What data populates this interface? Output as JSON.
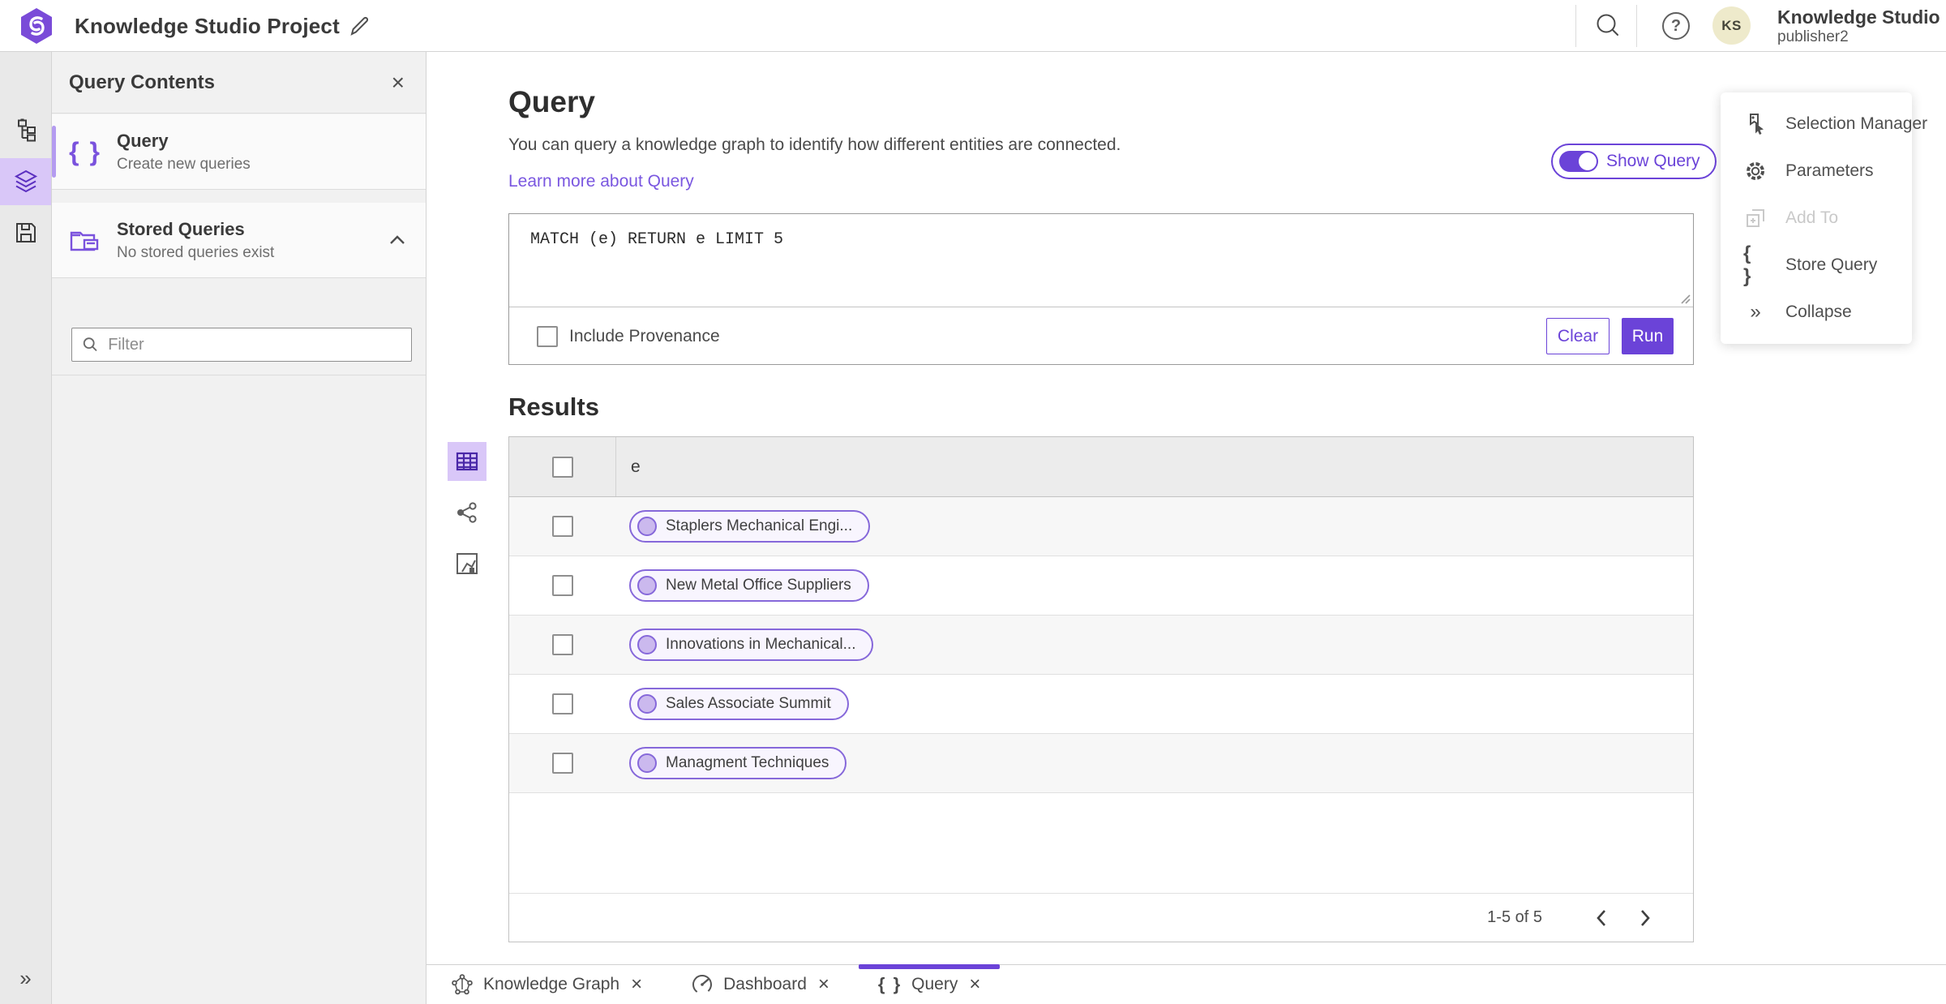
{
  "header": {
    "title": "Knowledge Studio Project",
    "account": {
      "initials": "KS",
      "org_name": "Knowledge Studio",
      "username": "publisher2"
    }
  },
  "contents_panel": {
    "title": "Query Contents",
    "query_item": {
      "title": "Query",
      "subtitle": "Create new queries"
    },
    "stored_item": {
      "title": "Stored Queries",
      "subtitle": "No stored queries exist"
    },
    "filter_placeholder": "Filter"
  },
  "query_section": {
    "heading": "Query",
    "description": "You can query a knowledge graph to identify how different entities are connected.",
    "learn_more": "Learn more about Query",
    "show_query_label": "Show Query",
    "query_text": "MATCH (e) RETURN e LIMIT 5",
    "include_provenance_label": "Include Provenance",
    "clear_label": "Clear",
    "run_label": "Run"
  },
  "results": {
    "heading": "Results",
    "column_header": "e",
    "rows": [
      "Staplers Mechanical Engi...",
      "New Metal Office Suppliers",
      "Innovations in Mechanical...",
      "Sales Associate Summit",
      "Managment Techniques"
    ],
    "pagination": "1-5 of 5"
  },
  "actions_menu": {
    "items": [
      {
        "label": "Selection Manager",
        "icon": "selection-manager-icon",
        "disabled": false
      },
      {
        "label": "Parameters",
        "icon": "gear-icon",
        "disabled": false
      },
      {
        "label": "Add To",
        "icon": "add-to-icon",
        "disabled": true
      },
      {
        "label": "Store Query",
        "icon": "braces-icon",
        "disabled": false
      },
      {
        "label": "Collapse",
        "icon": "double-chevron-icon",
        "disabled": false
      }
    ]
  },
  "bottom_tabs": [
    {
      "label": "Knowledge Graph",
      "icon": "graph-icon",
      "active": false
    },
    {
      "label": "Dashboard",
      "icon": "dashboard-icon",
      "active": false
    },
    {
      "label": "Query",
      "icon": "braces-icon",
      "active": true
    }
  ],
  "glyphs": {
    "close": "×",
    "braces": "{ }",
    "help": "?",
    "double_chevron_right": "»"
  },
  "colors": {
    "accent": "#6b43d8",
    "accent_light": "#d9c7f8",
    "link": "#7a57e0",
    "selected_rail": "#d9c7f8"
  }
}
